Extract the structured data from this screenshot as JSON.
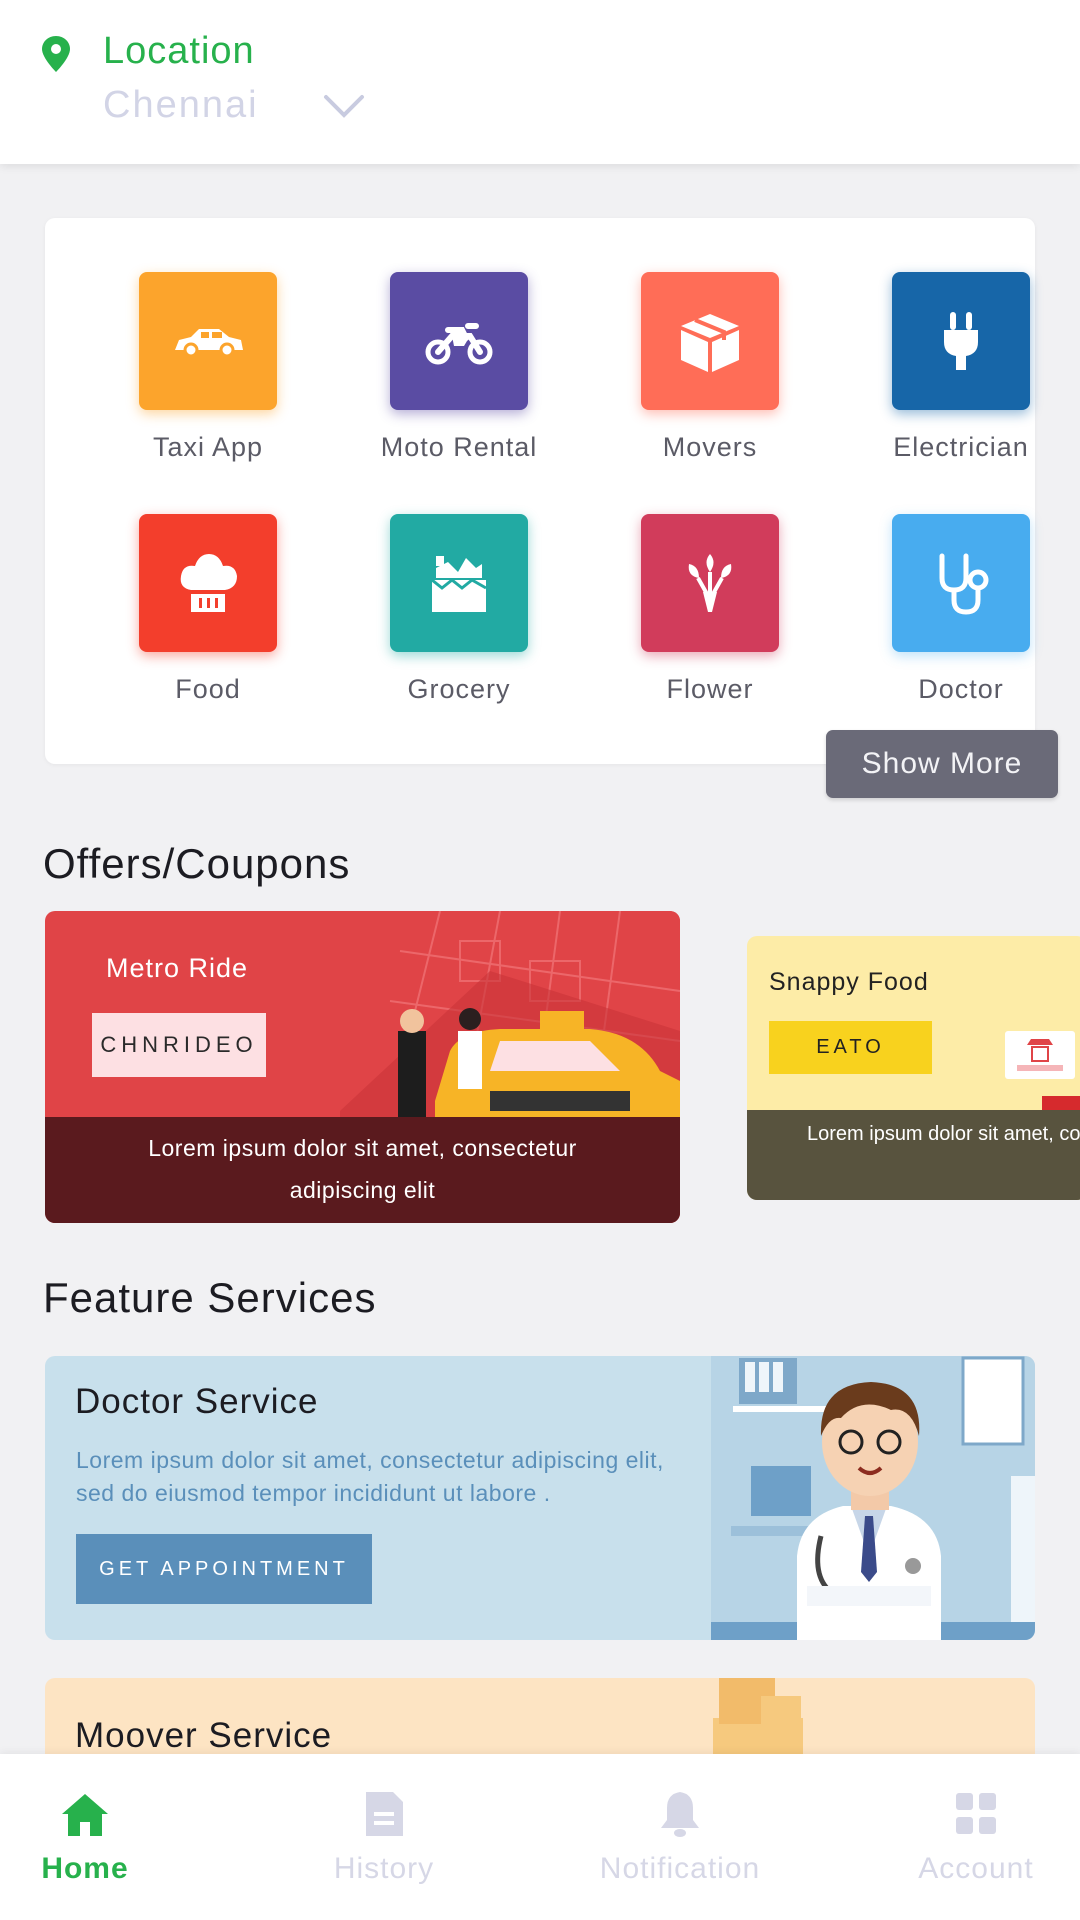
{
  "header": {
    "location_label": "Location",
    "city": "Chennai",
    "pin_icon": "location-pin-icon",
    "chevron_icon": "chevron-down-icon"
  },
  "services": [
    {
      "label": "Taxi App",
      "color": "#fca42c",
      "icon": "car-icon"
    },
    {
      "label": "Moto Rental",
      "color": "#5a4ca3",
      "icon": "motorbike-icon"
    },
    {
      "label": "Movers",
      "color": "#ff6d57",
      "icon": "box-icon"
    },
    {
      "label": "Electrician",
      "color": "#1766a8",
      "icon": "plug-icon"
    },
    {
      "label": "Food",
      "color": "#f33e2c",
      "icon": "chef-hat-icon"
    },
    {
      "label": "Grocery",
      "color": "#22aaa3",
      "icon": "grocery-icon"
    },
    {
      "label": "Flower",
      "color": "#d13c5b",
      "icon": "flower-icon"
    },
    {
      "label": "Doctor",
      "color": "#48acef",
      "icon": "stethoscope-icon"
    }
  ],
  "show_more": "Show More",
  "offers_title": "Offers/Coupons",
  "offers": [
    {
      "title": "Metro Ride",
      "code": "CHNRIDEO",
      "text": "Lorem ipsum dolor sit amet, consectetur adipiscing elit"
    },
    {
      "title": "Snappy Food",
      "code": "EATO",
      "text": "Lorem ipsum dolor sit amet, consectetur adipiscing elit"
    }
  ],
  "features_title": "Feature Services",
  "features": [
    {
      "title": "Doctor Service",
      "desc": "Lorem ipsum dolor sit amet, consectetur adipiscing elit, sed do eiusmod tempor incididunt ut labore .",
      "button": "GET APPOINTMENT"
    },
    {
      "title": "Moover Service"
    }
  ],
  "nav": [
    {
      "label": "Home",
      "icon": "home-icon",
      "active": true
    },
    {
      "label": "History",
      "icon": "history-icon",
      "active": false
    },
    {
      "label": "Notification",
      "icon": "bell-icon",
      "active": false
    },
    {
      "label": "Account",
      "icon": "account-grid-icon",
      "active": false
    }
  ],
  "colors": {
    "accent": "#27b14c",
    "inactive": "#d6d7e6"
  }
}
